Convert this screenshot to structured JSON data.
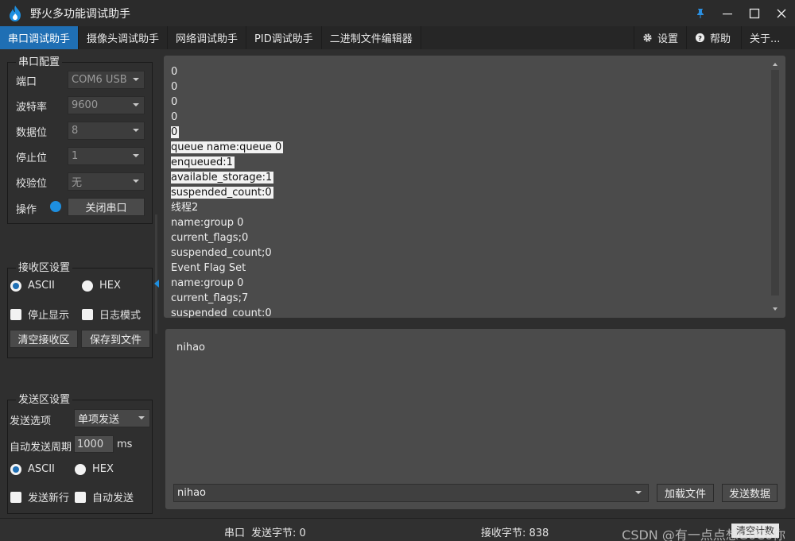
{
  "window": {
    "title": "野火多功能调试助手",
    "icons": {
      "app": "flame-icon",
      "pin": "pin-icon",
      "minimize": "minimize-icon",
      "maximize": "maximize-icon",
      "close": "close-icon"
    },
    "colors": {
      "accent": "#1f6fb4",
      "indicator": "#1e8fe0"
    }
  },
  "tabs": [
    {
      "label": "串口调试助手",
      "active": true
    },
    {
      "label": "摄像头调试助手"
    },
    {
      "label": "网络调试助手"
    },
    {
      "label": "PID调试助手"
    },
    {
      "label": "二进制文件编辑器"
    }
  ],
  "toolbar": {
    "settings": "设置",
    "help": "帮助",
    "about": "关于..."
  },
  "serial_config": {
    "title": "串口配置",
    "port": {
      "label": "端口",
      "value": "COM6 USB"
    },
    "baud": {
      "label": "波特率",
      "value": "9600"
    },
    "databits": {
      "label": "数据位",
      "value": "8"
    },
    "stopbits": {
      "label": "停止位",
      "value": "1"
    },
    "parity": {
      "label": "校验位",
      "value": "无"
    },
    "operation": {
      "label": "操作",
      "button": "关闭串口"
    }
  },
  "receive_settings": {
    "title": "接收区设置",
    "ascii": "ASCII",
    "hex": "HEX",
    "stop_display": "停止显示",
    "log_mode": "日志模式",
    "clear_button": "清空接收区",
    "save_button": "保存到文件"
  },
  "send_settings": {
    "title": "发送区设置",
    "option_label": "发送选项",
    "option_value": "单项发送",
    "period_label": "自动发送周期",
    "period_value": "1000",
    "period_unit": "ms",
    "ascii": "ASCII",
    "hex": "HEX",
    "newline": "发送新行",
    "auto_send": "自动发送"
  },
  "receive_area": {
    "lines": [
      {
        "text": "0"
      },
      {
        "text": "0"
      },
      {
        "text": "0"
      },
      {
        "text": "0"
      },
      {
        "text": "0",
        "selected": true
      },
      {
        "text": "queue name:queue 0",
        "selected": true
      },
      {
        "text": "enqueued:1",
        "selected": true
      },
      {
        "text": "available_storage:1",
        "selected": true
      },
      {
        "text": "suspended_count:0",
        "selected": true
      },
      {
        "text": "线程2"
      },
      {
        "text": "name:group 0"
      },
      {
        "text": "current_flags;0"
      },
      {
        "text": "suspended_count;0"
      },
      {
        "text": "Event Flag Set"
      },
      {
        "text": "name:group 0"
      },
      {
        "text": "current_flags;7"
      },
      {
        "text": "suspended_count:0"
      }
    ]
  },
  "send_area": {
    "text": "nihao",
    "history_value": "nihao",
    "load_button": "加载文件",
    "send_button": "发送数据"
  },
  "status": {
    "port_label": "串口",
    "sent_bytes": "发送字节: 0",
    "recv_bytes": "接收字节: 838",
    "clear_count": "清空计数",
    "watermark": "CSDN @有一点点想GoCo你"
  }
}
